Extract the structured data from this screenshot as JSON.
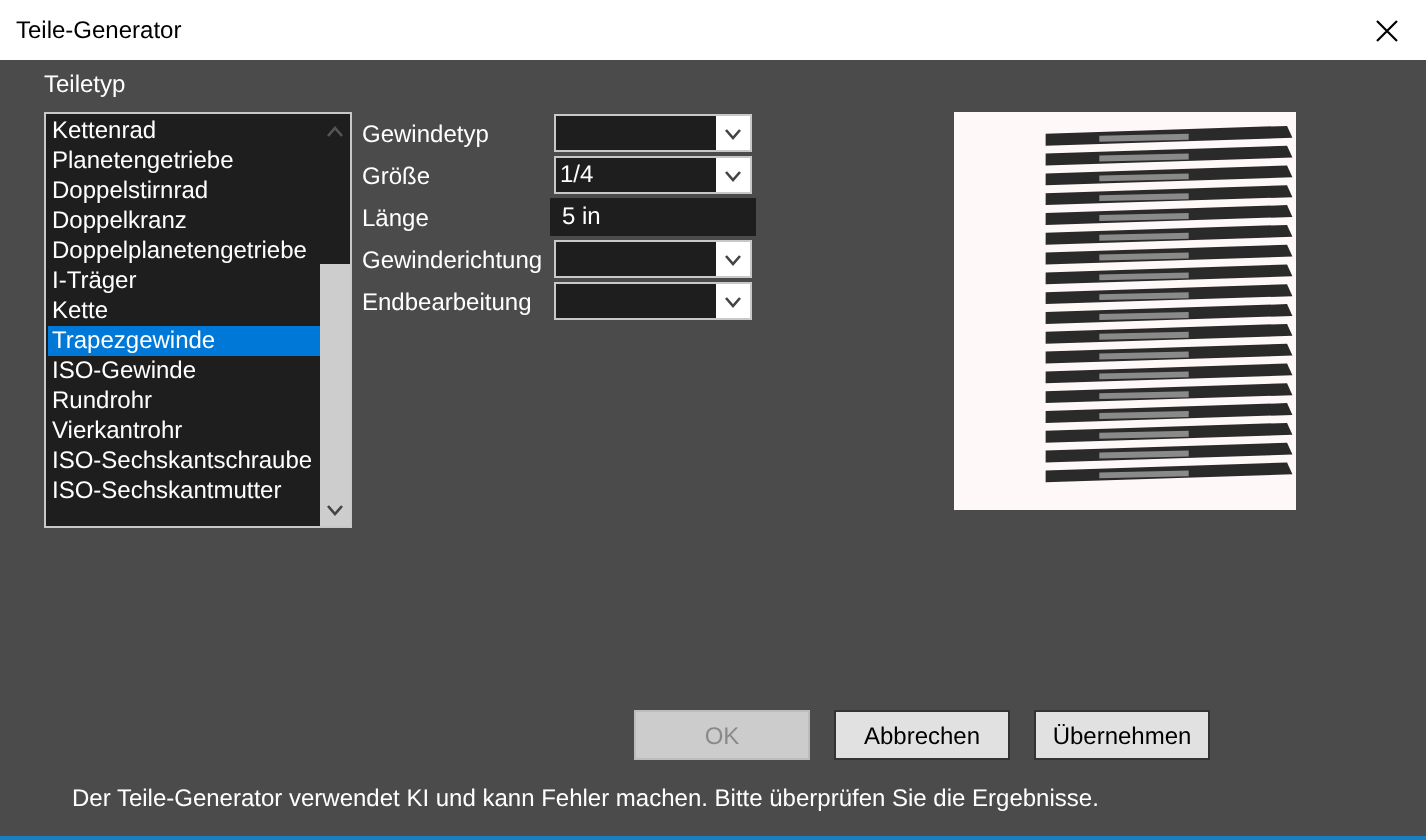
{
  "window": {
    "title": "Teile-Generator"
  },
  "part_type": {
    "label": "Teiletyp",
    "items": [
      {
        "label": "Kettenrad",
        "selected": false
      },
      {
        "label": "Planetengetriebe",
        "selected": false
      },
      {
        "label": "Doppelstirnrad",
        "selected": false
      },
      {
        "label": "Doppelkranz",
        "selected": false
      },
      {
        "label": "Doppelplanetengetriebe",
        "selected": false
      },
      {
        "label": "I-Träger",
        "selected": false
      },
      {
        "label": "Kette",
        "selected": false
      },
      {
        "label": "Trapezgewinde",
        "selected": true
      },
      {
        "label": "ISO-Gewinde",
        "selected": false
      },
      {
        "label": "Rundrohr",
        "selected": false
      },
      {
        "label": "Vierkantrohr",
        "selected": false
      },
      {
        "label": "ISO-Sechskantschraube",
        "selected": false
      },
      {
        "label": "ISO-Sechskantmutter",
        "selected": false
      }
    ]
  },
  "fields": [
    {
      "label": "Gewindetyp",
      "kind": "dropdown"
    },
    {
      "label": "Größe",
      "kind": "dropdown",
      "value": "1/4"
    },
    {
      "label": "Länge",
      "kind": "text",
      "value": "5 in"
    },
    {
      "label": "Gewinderichtung",
      "kind": "dropdown"
    },
    {
      "label": "Endbearbeitung",
      "kind": "dropdown"
    }
  ],
  "buttons": [
    {
      "label": "OK",
      "disabled": true
    },
    {
      "label": "Abbrechen",
      "disabled": false
    },
    {
      "label": "Übernehmen",
      "disabled": false
    }
  ],
  "footer": "Der Teile-Generator verwendet KI und kann Fehler machen. Bitte überprüfen Sie die Ergebnisse."
}
